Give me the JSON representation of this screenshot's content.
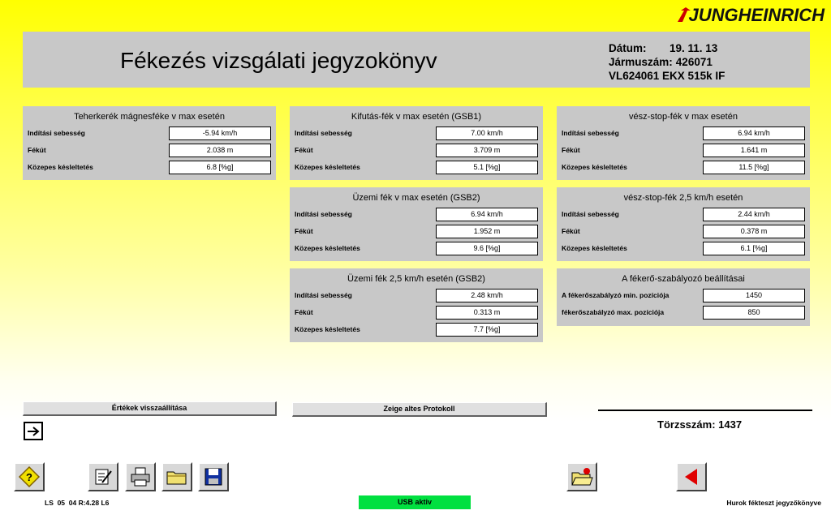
{
  "brand": {
    "logo_text": "JUNGHEINRICH"
  },
  "header": {
    "title": "Fékezés vizsgálati jegyzokönyv",
    "date_label": "Dátum:",
    "date_value": "19. 11. 13",
    "vehicle_label": "Jármuszám:",
    "vehicle_value": "426071",
    "model": "VL624061 EKX 515k IF"
  },
  "panels": {
    "p1": {
      "title": "Teherkerék mágnesféke v max esetén",
      "rows": [
        {
          "label": "Indítási sebesség",
          "value": "-5.94 km/h"
        },
        {
          "label": "Fékút",
          "value": "2.038 m"
        },
        {
          "label": "Közepes késleltetés",
          "value": "6.8 [%g]"
        }
      ]
    },
    "p2": {
      "title": "Kifutás-fék v max esetén (GSB1)",
      "rows": [
        {
          "label": "Indítási sebesség",
          "value": "7.00 km/h"
        },
        {
          "label": "Fékút",
          "value": "3.709 m"
        },
        {
          "label": "Közepes késleltetés",
          "value": "5.1 [%g]"
        }
      ]
    },
    "p3": {
      "title": "vész-stop-fék v max esetén",
      "rows": [
        {
          "label": "Indítási sebesség",
          "value": "6.94 km/h"
        },
        {
          "label": "Fékút",
          "value": "1.641 m"
        },
        {
          "label": "Közepes késleltetés",
          "value": "11.5 [%g]"
        }
      ]
    },
    "p4": {
      "title": "Üzemi fék v max esetén (GSB2)",
      "rows": [
        {
          "label": "Indítási sebesség",
          "value": "6.94 km/h"
        },
        {
          "label": "Fékút",
          "value": "1.952 m"
        },
        {
          "label": "Közepes késleltetés",
          "value": "9.6 [%g]"
        }
      ]
    },
    "p5": {
      "title": "vész-stop-fék 2,5 km/h esetén",
      "rows": [
        {
          "label": "Indítási sebesség",
          "value": "2.44 km/h"
        },
        {
          "label": "Fékút",
          "value": "0.378 m"
        },
        {
          "label": "Közepes késleltetés",
          "value": "6.1 [%g]"
        }
      ]
    },
    "p6": {
      "title": "Üzemi fék 2,5 km/h esetén (GSB2)",
      "rows": [
        {
          "label": "Indítási sebesség",
          "value": "2.48 km/h"
        },
        {
          "label": "Fékút",
          "value": "0.313 m"
        },
        {
          "label": "Közepes késleltetés",
          "value": "7.7 [%g]"
        }
      ]
    },
    "p7": {
      "title": "A fékerő-szabályozó beállításai",
      "rows": [
        {
          "label": "A fékerőszabályzó min. pozíciója",
          "value": "1450"
        },
        {
          "label": "fékerőszabályzó max. pozíciója",
          "value": "850"
        }
      ]
    }
  },
  "actions": {
    "reset_label": "Értékek visszaállítása",
    "old_protocol_label": "Zeige altes Protokoll"
  },
  "torzs": {
    "label": "Törzsszám:",
    "value": "1437"
  },
  "footer": {
    "left_status": "LS  05  04 R:4.28 L6",
    "usb_status": "USB aktiv",
    "right_title": "Hurok fékteszt jegyzőkönyve"
  },
  "toolbar_icons": [
    "help-icon",
    "edit-icon",
    "print-icon",
    "folder-icon",
    "save-icon",
    "open-folder-icon",
    "back-arrow-icon"
  ],
  "colors": {
    "accent_red": "#cc0000",
    "usb_green": "#00e040",
    "panel_gray": "#c8c8c8"
  }
}
